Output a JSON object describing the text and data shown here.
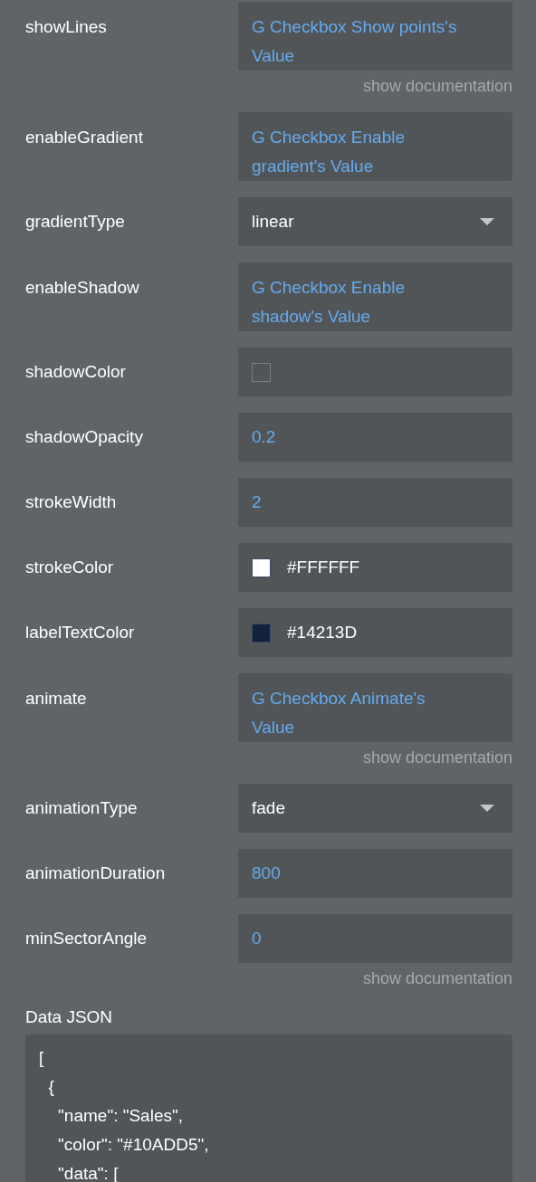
{
  "rows": [
    {
      "label": "showLines",
      "kind": "dynamic",
      "value": "G Checkbox Show points's Value",
      "doc": "show documentation"
    },
    {
      "label": "enableGradient",
      "kind": "dynamic",
      "value": "G Checkbox Enable gradient's Value"
    },
    {
      "label": "gradientType",
      "kind": "dropdown",
      "value": "linear"
    },
    {
      "label": "enableShadow",
      "kind": "dynamic",
      "value": "G Checkbox Enable shadow's Value"
    },
    {
      "label": "shadowColor",
      "kind": "color"
    },
    {
      "label": "shadowOpacity",
      "kind": "number",
      "value": "0.2"
    },
    {
      "label": "strokeWidth",
      "kind": "number",
      "value": "2"
    },
    {
      "label": "strokeColor",
      "kind": "color",
      "value": "#FFFFFF",
      "color": "#ffffff"
    },
    {
      "label": "labelTextColor",
      "kind": "color",
      "value": "#14213D",
      "color": "#14213d"
    },
    {
      "label": "animate",
      "kind": "dynamic",
      "value": "G Checkbox Animate's Value",
      "doc": "show documentation"
    },
    {
      "label": "animationType",
      "kind": "dropdown",
      "value": "fade"
    },
    {
      "label": "animationDuration",
      "kind": "number",
      "value": "800"
    },
    {
      "label": "minSectorAngle",
      "kind": "number",
      "value": "0",
      "doc": "show documentation"
    }
  ],
  "data_json": {
    "label": "Data JSON",
    "lines": [
      "[",
      "  {",
      "    \"name\": \"Sales\",",
      "    \"color\": \"#10ADD5\",",
      "    \"data\": ["
    ]
  }
}
